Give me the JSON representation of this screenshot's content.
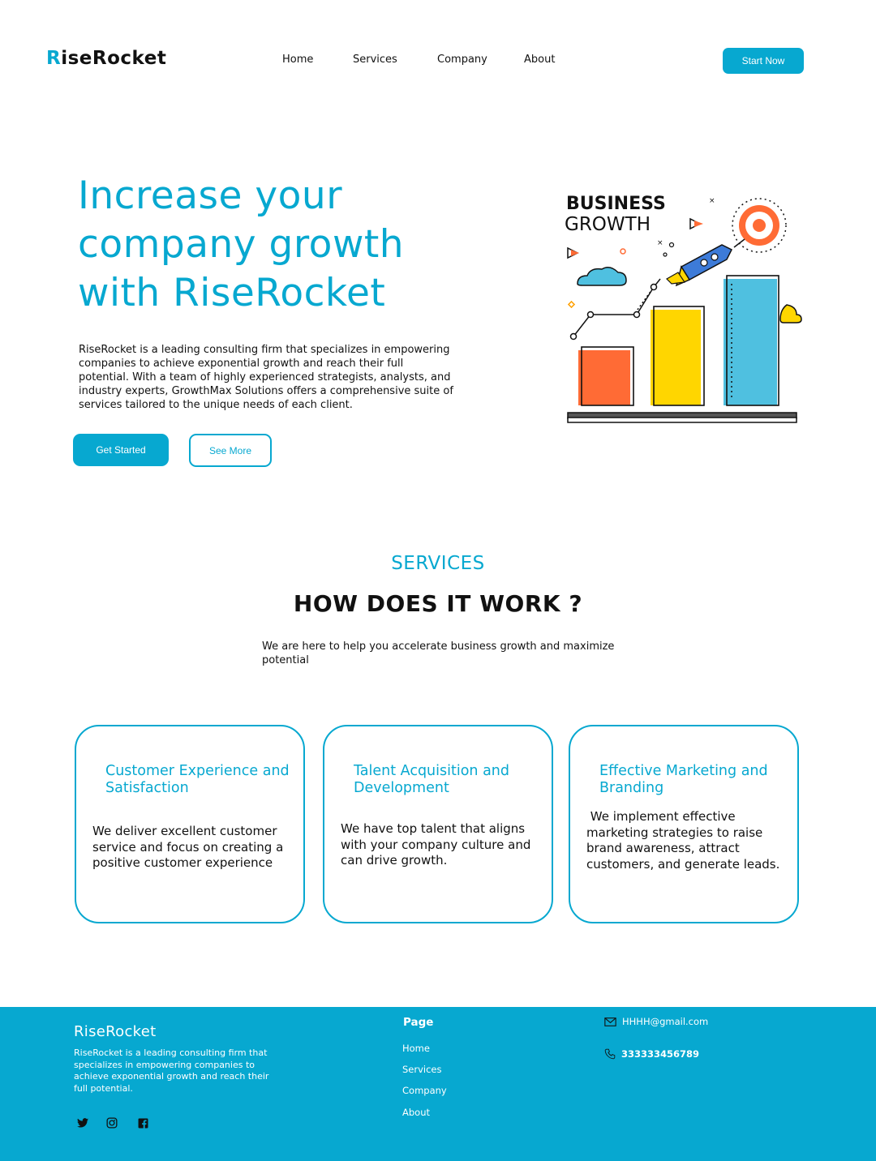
{
  "nav": {
    "logo_first": "R",
    "logo_rest": "iseRocket",
    "links": [
      "Home",
      "Services",
      "Company",
      "About"
    ],
    "cta": "Start Now"
  },
  "hero": {
    "title_lines": [
      "Increase your",
      "company growth",
      "with RiseRocket"
    ],
    "description": "RiseRocket is a leading consulting firm that specializes in empowering companies to achieve exponential growth and reach their full potential. With a team of highly experienced strategists, analysts, and industry experts, GrowthMax Solutions offers a comprehensive suite of services tailored to the unique needs of each client.",
    "primary_button": "Get Started",
    "secondary_button": "See More",
    "illustration": {
      "title_bold": "BUSINESS",
      "title_light": "GROWTH"
    }
  },
  "services": {
    "eyebrow": "SERVICES",
    "title": "HOW DOES IT WORK ?",
    "subtitle": "We are here to help you  accelerate business growth and maximize potential",
    "cards": [
      {
        "title": "Customer Experience and Satisfaction",
        "text": "We deliver excellent customer service and focus on creating a positive customer experience"
      },
      {
        "title": "Talent Acquisition and Development",
        "text": "We have top talent that aligns with your company culture and can drive growth."
      },
      {
        "title": "Effective Marketing and Branding",
        "text": " We implement effective marketing strategies to raise brand awareness, attract customers, and generate leads."
      }
    ]
  },
  "footer": {
    "brand": "RiseRocket",
    "description": "RiseRocket is a leading consulting firm that specializes in empowering companies to achieve exponential growth and reach their full potential.",
    "page_heading": "Page",
    "links": [
      "Home",
      "Services",
      "Company",
      "About"
    ],
    "email": "HHHH@gmail.com",
    "phone": "333333456789",
    "social_icons": [
      "twitter-icon",
      "instagram-icon",
      "facebook-icon"
    ]
  },
  "colors": {
    "accent": "#07a8d0",
    "text": "#111111",
    "bar_orange": "#ff6b35",
    "bar_yellow": "#ffd600",
    "bar_blue": "#4fc0e0"
  }
}
